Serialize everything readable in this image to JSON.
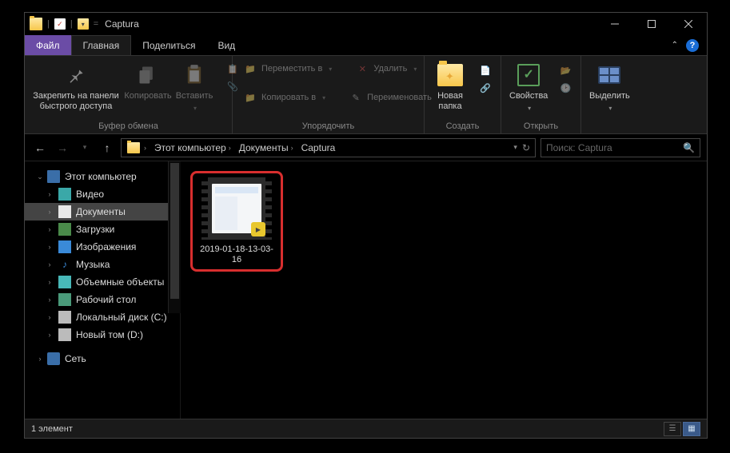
{
  "titlebar": {
    "title": "Captura"
  },
  "tabs": {
    "file": "Файл",
    "items": [
      "Главная",
      "Поделиться",
      "Вид"
    ]
  },
  "ribbon": {
    "clipboard": {
      "pin": "Закрепить на панели\nбыстрого доступа",
      "copy": "Копировать",
      "paste": "Вставить",
      "label": "Буфер обмена"
    },
    "organize": {
      "move": "Переместить в",
      "copyto": "Копировать в",
      "delete": "Удалить",
      "rename": "Переименовать",
      "label": "Упорядочить"
    },
    "create": {
      "newfolder": "Новая\nпапка",
      "label": "Создать"
    },
    "open": {
      "props": "Свойства",
      "label": "Открыть"
    },
    "select": {
      "select": "Выделить",
      "label": ""
    }
  },
  "address": {
    "segments": [
      "Этот компьютер",
      "Документы",
      "Captura"
    ]
  },
  "search": {
    "placeholder": "Поиск: Captura"
  },
  "sidebar": {
    "root": "Этот компьютер",
    "items": [
      {
        "label": "Видео",
        "icon": "video"
      },
      {
        "label": "Документы",
        "icon": "doc",
        "active": true
      },
      {
        "label": "Загрузки",
        "icon": "download"
      },
      {
        "label": "Изображения",
        "icon": "image"
      },
      {
        "label": "Музыка",
        "icon": "music"
      },
      {
        "label": "Объемные объекты",
        "icon": "3d"
      },
      {
        "label": "Рабочий стол",
        "icon": "desktop"
      },
      {
        "label": "Локальный диск (C:)",
        "icon": "drive"
      },
      {
        "label": "Новый том (D:)",
        "icon": "drive"
      }
    ],
    "network": "Сеть"
  },
  "content": {
    "file_name": "2019-01-18-13-03-16"
  },
  "status": {
    "text": "1 элемент"
  }
}
